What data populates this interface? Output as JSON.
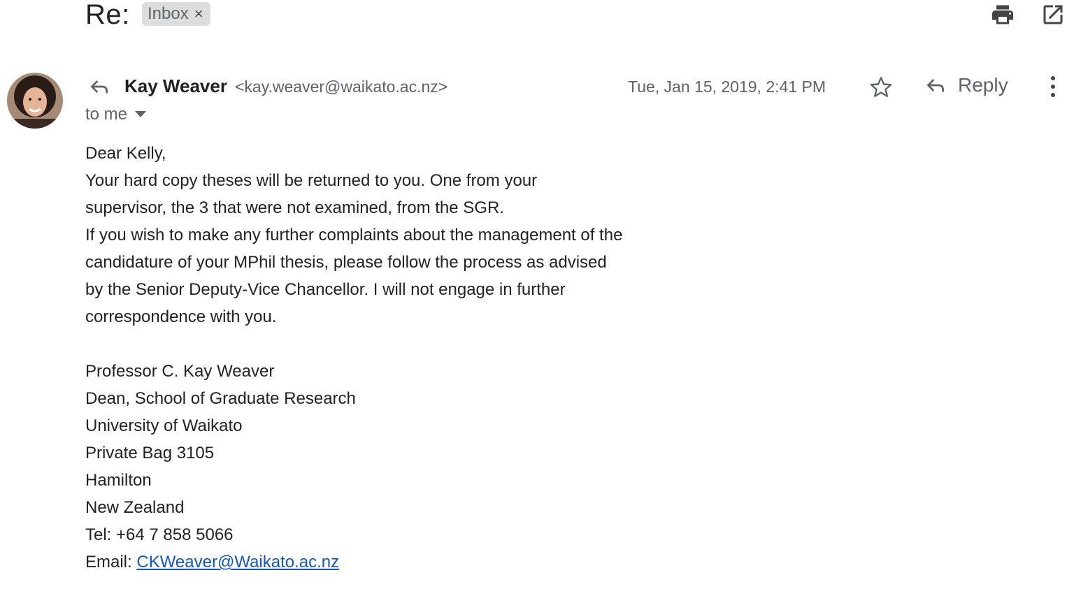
{
  "subject": {
    "title": "Re:",
    "label": "Inbox",
    "label_close": "×"
  },
  "toolbar": {
    "print_icon": "print-icon",
    "popout_icon": "open-in-new-window-icon"
  },
  "message": {
    "sender_name": "Kay Weaver",
    "sender_email": "<kay.weaver@waikato.ac.nz>",
    "recipient": "to me",
    "date": "Tue, Jan 15, 2019, 2:41 PM",
    "reply_label": "Reply",
    "body_lines": [
      "Dear Kelly,",
      "Your hard copy theses will be returned to you. One from your",
      "supervisor, the 3 that were not examined, from the SGR.",
      "If you wish to make any further complaints about the management of the",
      "candidature of your MPhil thesis, please follow the process as advised",
      "by the Senior Deputy-Vice Chancellor. I will not engage in further",
      "correspondence with you."
    ],
    "signature": [
      "Professor C. Kay Weaver",
      "Dean, School of Graduate Research",
      "University of Waikato",
      "Private Bag 3105",
      "Hamilton",
      "New Zealand",
      "Tel: +64 7 858 5066"
    ],
    "email_prefix": "Email: ",
    "email_link": "CKWeaver@Waikato.ac.nz"
  },
  "colors": {
    "text": "#202124",
    "muted": "#5f6368",
    "chip_bg": "#dddddd",
    "link": "#1155cc"
  }
}
